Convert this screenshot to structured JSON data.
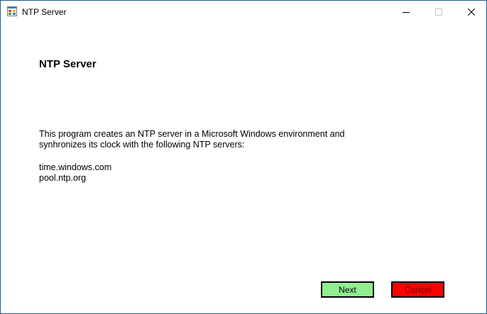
{
  "window": {
    "title": "NTP Server"
  },
  "content": {
    "heading": "NTP Server",
    "description_line1": "This program creates an NTP server in a Microsoft Windows environment and",
    "description_line2": "synhronizes its clock with the following NTP servers:",
    "servers": [
      "time.windows.com",
      "pool.ntp.org"
    ]
  },
  "buttons": {
    "next_label": "Next",
    "cancel_label": "Cancel"
  },
  "colors": {
    "next_bg": "#90ee90",
    "cancel_bg": "#ff0000",
    "border": "#1e5c8a"
  },
  "icons": {
    "app": "app-window-icon",
    "minimize": "minimize-icon",
    "maximize": "maximize-icon",
    "close": "close-icon"
  }
}
